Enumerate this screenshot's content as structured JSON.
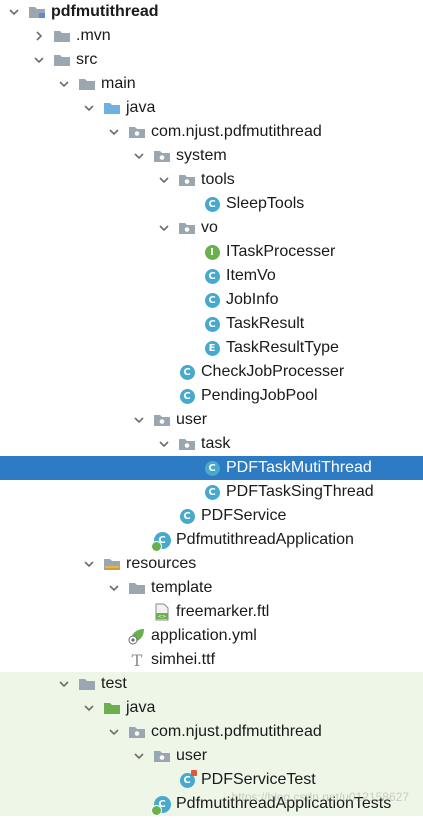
{
  "tree": [
    {
      "label": "pdfmutithread",
      "depth": 0,
      "arrow": "down",
      "icon": "module-folder",
      "bold": true
    },
    {
      "label": ".mvn",
      "depth": 1,
      "arrow": "right",
      "icon": "folder"
    },
    {
      "label": "src",
      "depth": 1,
      "arrow": "down",
      "icon": "folder"
    },
    {
      "label": "main",
      "depth": 2,
      "arrow": "down",
      "icon": "folder"
    },
    {
      "label": "java",
      "depth": 3,
      "arrow": "down",
      "icon": "source-folder"
    },
    {
      "label": "com.njust.pdfmutithread",
      "depth": 4,
      "arrow": "down",
      "icon": "package"
    },
    {
      "label": "system",
      "depth": 5,
      "arrow": "down",
      "icon": "package"
    },
    {
      "label": "tools",
      "depth": 6,
      "arrow": "down",
      "icon": "package"
    },
    {
      "label": "SleepTools",
      "depth": 7,
      "arrow": "none",
      "icon": "class"
    },
    {
      "label": "vo",
      "depth": 6,
      "arrow": "down",
      "icon": "package"
    },
    {
      "label": "ITaskProcesser",
      "depth": 7,
      "arrow": "none",
      "icon": "interface"
    },
    {
      "label": "ItemVo",
      "depth": 7,
      "arrow": "none",
      "icon": "class"
    },
    {
      "label": "JobInfo",
      "depth": 7,
      "arrow": "none",
      "icon": "class"
    },
    {
      "label": "TaskResult",
      "depth": 7,
      "arrow": "none",
      "icon": "class"
    },
    {
      "label": "TaskResultType",
      "depth": 7,
      "arrow": "none",
      "icon": "enum"
    },
    {
      "label": "CheckJobProcesser",
      "depth": 6,
      "arrow": "none",
      "icon": "class"
    },
    {
      "label": "PendingJobPool",
      "depth": 6,
      "arrow": "none",
      "icon": "class"
    },
    {
      "label": "user",
      "depth": 5,
      "arrow": "down",
      "icon": "package"
    },
    {
      "label": "task",
      "depth": 6,
      "arrow": "down",
      "icon": "package"
    },
    {
      "label": "PDFTaskMutiThread",
      "depth": 7,
      "arrow": "none",
      "icon": "class",
      "selected": true
    },
    {
      "label": "PDFTaskSingThread",
      "depth": 7,
      "arrow": "none",
      "icon": "class"
    },
    {
      "label": "PDFService",
      "depth": 6,
      "arrow": "none",
      "icon": "class"
    },
    {
      "label": "PdfmutithreadApplication",
      "depth": 5,
      "arrow": "none",
      "icon": "spring-class"
    },
    {
      "label": "resources",
      "depth": 3,
      "arrow": "down",
      "icon": "resources-folder"
    },
    {
      "label": "template",
      "depth": 4,
      "arrow": "down",
      "icon": "folder"
    },
    {
      "label": "freemarker.ftl",
      "depth": 5,
      "arrow": "none",
      "icon": "ftl-file"
    },
    {
      "label": "application.yml",
      "depth": 4,
      "arrow": "none",
      "icon": "yml-file"
    },
    {
      "label": "simhei.ttf",
      "depth": 4,
      "arrow": "none",
      "icon": "font-file"
    },
    {
      "label": "test",
      "depth": 2,
      "arrow": "down",
      "icon": "folder",
      "test": true
    },
    {
      "label": "java",
      "depth": 3,
      "arrow": "down",
      "icon": "test-source-folder",
      "test": true
    },
    {
      "label": "com.njust.pdfmutithread",
      "depth": 4,
      "arrow": "down",
      "icon": "package",
      "test": true
    },
    {
      "label": "user",
      "depth": 5,
      "arrow": "down",
      "icon": "package",
      "test": true
    },
    {
      "label": "PDFServiceTest",
      "depth": 6,
      "arrow": "none",
      "icon": "test-class",
      "test": true
    },
    {
      "label": "PdfmutithreadApplicationTests",
      "depth": 5,
      "arrow": "none",
      "icon": "spring-class",
      "test": true
    }
  ],
  "watermark": "https://blog.csdn.net/u012158627",
  "colors": {
    "selection": "#2d7bc4",
    "class": "#46a9cd",
    "interface": "#6ab04c",
    "test_bg": "#eef6e8",
    "folder": "#9aa7b0",
    "source_folder": "#6fb0e0",
    "test_folder": "#6ab04c"
  }
}
